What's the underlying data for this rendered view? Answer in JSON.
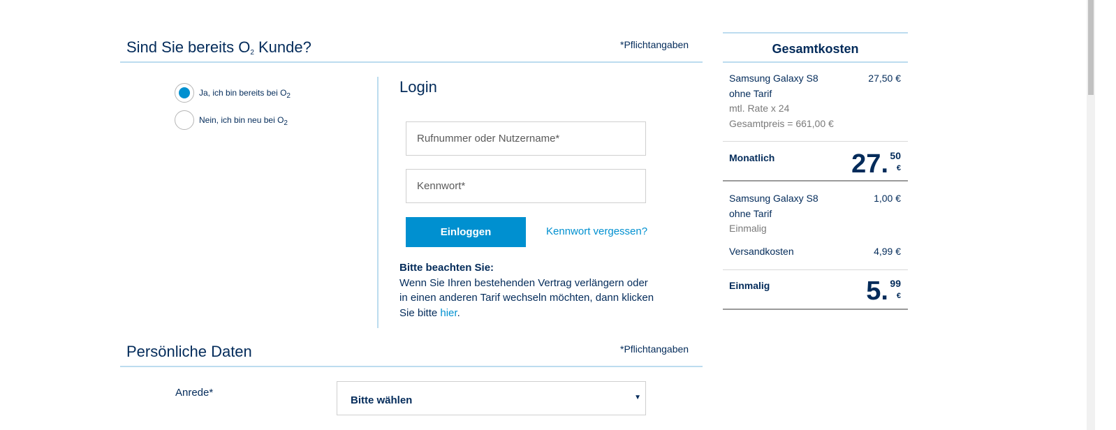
{
  "customer_section": {
    "title_prefix": "Sind Sie bereits O",
    "title_sub": "2",
    "title_suffix": " Kunde?",
    "required_note": "*Pflichtangaben",
    "options": [
      {
        "label": "Ja, ich bin bereits bei O",
        "sub": "2",
        "selected": true
      },
      {
        "label": "Nein, ich bin neu bei O",
        "sub": "2",
        "selected": false
      }
    ]
  },
  "login": {
    "title": "Login",
    "username_placeholder": "Rufnummer oder Nutzername*",
    "password_placeholder": "Kennwort*",
    "submit_label": "Einloggen",
    "forgot_link": "Kennwort vergessen?",
    "notice_heading": "Bitte beachten Sie:",
    "notice_text": "Wenn Sie Ihren bestehenden Vertrag verlängern oder in einen anderen Tarif wechseln möchten, dann klicken Sie bitte",
    "notice_link": "hier",
    "notice_end": "."
  },
  "personal_section": {
    "title": "Persönliche Daten",
    "required_note": "*Pflichtangaben",
    "salutation_label": "Anrede*",
    "salutation_value": "Bitte wählen"
  },
  "summary": {
    "title": "Gesamtkosten",
    "monthly_item": {
      "name_line1": "Samsung Galaxy S8",
      "name_line2": "ohne Tarif",
      "detail1": "mtl. Rate x 24",
      "detail2": "Gesamtpreis = 661,00 €",
      "price": "27,50 €"
    },
    "monthly_total": {
      "label": "Monatlich",
      "integer": "27.",
      "decimal": "50",
      "currency": "€"
    },
    "onetime_item": {
      "name_line1": "Samsung Galaxy S8",
      "name_line2": "ohne Tarif",
      "detail": "Einmalig",
      "price": "1,00 €"
    },
    "shipping": {
      "label": "Versandkosten",
      "price": "4,99 €"
    },
    "onetime_total": {
      "label": "Einmalig",
      "integer": "5.",
      "decimal": "99",
      "currency": "€"
    }
  },
  "colors": {
    "primary": "#0090D0",
    "text": "#032B5A",
    "rule": "#bcdcef"
  }
}
